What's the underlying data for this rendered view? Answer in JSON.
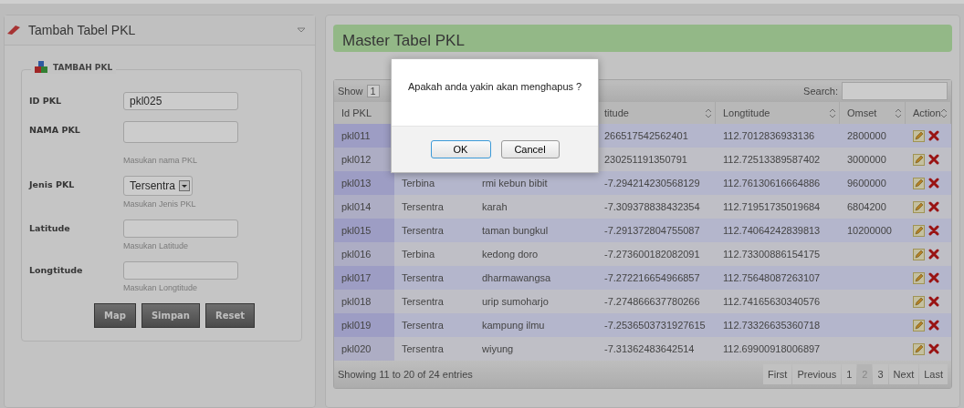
{
  "left_panel": {
    "title": "Tambah Tabel PKL",
    "fieldset": "TAMBAH PKL",
    "fields": [
      {
        "kind": "text",
        "label": "ID PKL",
        "value": "pkl025"
      },
      {
        "kind": "text",
        "label": "NAMA PKL",
        "hint": "Masukan nama PKL",
        "tall": true
      },
      {
        "kind": "select",
        "label": "Jenis PKL",
        "value": "Tersentra",
        "hint": "Masukan Jenis PKL"
      },
      {
        "kind": "text",
        "label": "Latitude",
        "hint": "Masukan Latitude"
      },
      {
        "kind": "text",
        "label": "Longtitude",
        "hint": "Masukan Longtitude"
      }
    ],
    "buttons": [
      "Map",
      "Simpan",
      "Reset"
    ]
  },
  "main": {
    "title": "Master Tabel PKL",
    "show_label": "Show",
    "show_value": "1",
    "search_label": "Search:",
    "columns": [
      {
        "label": "Id PKL"
      },
      {},
      {},
      {
        "label": "titude"
      },
      {
        "label": "Longtitude"
      },
      {
        "label": "Omset"
      },
      {
        "label": "Action"
      }
    ],
    "rows": [
      {
        "id": "pkl011",
        "lat": "266517542562401",
        "lng": "112.7012836933136",
        "omset": "2800000"
      },
      {
        "id": "pkl012",
        "lat": "230251191350791",
        "lng": "112.72513389587402",
        "omset": "3000000"
      },
      {
        "id": "pkl013",
        "jenis": "Terbina",
        "nama": "rmi kebun bibit",
        "lat": "-7.294214230568129",
        "lng": "112.76130616664886",
        "omset": "9600000"
      },
      {
        "id": "pkl014",
        "jenis": "Tersentra",
        "nama": "karah",
        "lat": "-7.309378838432354",
        "lng": "112.71951735019684",
        "omset": "6804200"
      },
      {
        "id": "pkl015",
        "jenis": "Tersentra",
        "nama": "taman bungkul",
        "lat": "-7.291372804755087",
        "lng": "112.74064242839813",
        "omset": "10200000"
      },
      {
        "id": "pkl016",
        "jenis": "Terbina",
        "nama": "kedong doro",
        "lat": "-7.273600182082091",
        "lng": "112.73300886154175"
      },
      {
        "id": "pkl017",
        "jenis": "Tersentra",
        "nama": "dharmawangsa",
        "lat": "-7.272216654966857",
        "lng": "112.75648087263107"
      },
      {
        "id": "pkl018",
        "jenis": "Tersentra",
        "nama": "urip sumoharjo",
        "lat": "-7.274866637780266",
        "lng": "112.74165630340576"
      },
      {
        "id": "pkl019",
        "jenis": "Tersentra",
        "nama": "kampung ilmu",
        "lat": "-7.2536503731927615",
        "lng": "112.73326635360718"
      },
      {
        "id": "pkl020",
        "jenis": "Tersentra",
        "nama": "wiyung",
        "lat": "-7.31362483642514",
        "lng": "112.69900918006897"
      }
    ],
    "info": "Showing 11 to 20 of 24 entries",
    "pages": [
      {
        "label": "First",
        "selected": false
      },
      {
        "label": "Previous",
        "selected": false
      },
      {
        "label": "1",
        "selected": false
      },
      {
        "label": "2",
        "selected": true
      },
      {
        "label": "3",
        "selected": false
      },
      {
        "label": "Next",
        "selected": false
      },
      {
        "label": "Last",
        "selected": false
      }
    ]
  },
  "dialog": {
    "message": "Apakah anda yakin akan menghapus ?",
    "buttons": [
      {
        "label": "OK",
        "kind": "primary"
      },
      {
        "label": "Cancel",
        "kind": "secondary"
      }
    ]
  }
}
